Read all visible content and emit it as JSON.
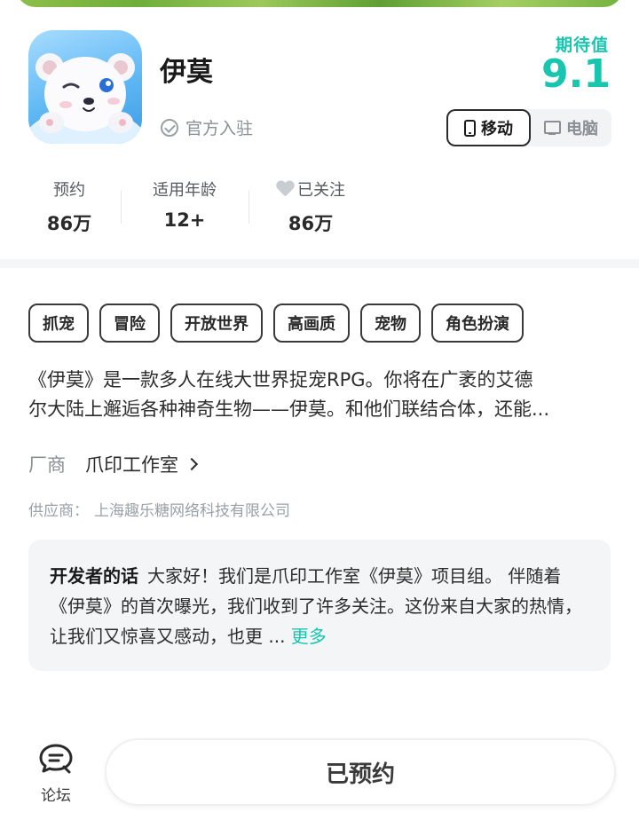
{
  "app": {
    "name": "伊莫",
    "official_badge": "官方入驻",
    "icon": "white-bear-mascot"
  },
  "score": {
    "label": "期待值",
    "value": "9.1",
    "color": "#18c6b0"
  },
  "device_toggle": {
    "options": [
      {
        "label": "移动",
        "icon": "phone-icon",
        "active": true
      },
      {
        "label": "电脑",
        "icon": "pc-icon",
        "active": false
      }
    ]
  },
  "stats": [
    {
      "label": "预约",
      "value": "86万"
    },
    {
      "label": "适用年龄",
      "value": "12+"
    },
    {
      "label": "已关注",
      "value": "86万",
      "icon": "heart-icon"
    }
  ],
  "tags": [
    "抓宠",
    "冒险",
    "开放世界",
    "高画质",
    "宠物",
    "角色扮演"
  ],
  "description": {
    "line1": "《伊莫》是一款多人在线大世界捉宠RPG。你将在广袤的艾德",
    "line2": "尔大陆上邂逅各种神奇生物——伊莫。和他们联结合体，还能..."
  },
  "vendor": {
    "label": "厂商",
    "name": "爪印工作室"
  },
  "supplier": {
    "label": "供应商：",
    "name": "上海趣乐糖网络科技有限公司"
  },
  "developer_note": {
    "title": "开发者的话",
    "text": "大家好！我们是爪印工作室《伊莫》项目组。 伴随着《伊莫》的首次曝光，我们收到了许多关注。这份来自大家的热情，让我们又惊喜又感动，也更 ...",
    "more": "更多"
  },
  "bottom_bar": {
    "forum_label": "论坛",
    "reserve_label": "已预约"
  }
}
